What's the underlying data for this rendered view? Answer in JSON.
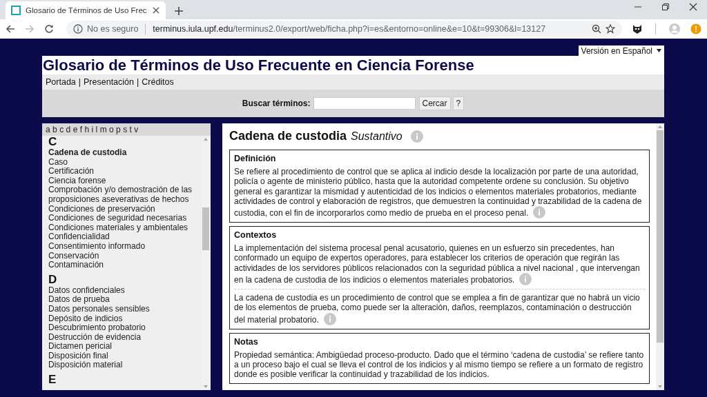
{
  "browser": {
    "tab_title": "Glosario de Términos de Uso Frec",
    "security": "No es seguro",
    "url_host": "terminus.iula.upf.edu",
    "url_path": "/terminus2.0/export/web/ficha.php?i=es&entorno=online&e=10&t=99306&l=13127"
  },
  "language_select": {
    "value": "Versión en Español"
  },
  "header": {
    "title": "Glosario de Términos de Uso Frecuente en Ciencia Forense",
    "nav_separator": "|",
    "nav": [
      "Portada",
      "Presentación",
      "Créditos"
    ],
    "search": {
      "label": "Buscar términos:",
      "button": "Cercar",
      "help": "?"
    }
  },
  "sidebar": {
    "alphabet": [
      "a",
      "b",
      "c",
      "d",
      "e",
      "f",
      "h",
      "i",
      "l",
      "m",
      "o",
      "p",
      "s",
      "t",
      "v"
    ],
    "groups": [
      {
        "letter": "C",
        "items": [
          {
            "label": "Cadena de custodia",
            "selected": true
          },
          {
            "label": "Caso",
            "selected": false
          },
          {
            "label": "Certificación",
            "selected": false
          },
          {
            "label": "Ciencia forense",
            "selected": false
          },
          {
            "label": "Comprobación y/o demostración de las proposiciones aseverativas de hechos",
            "selected": false
          },
          {
            "label": "Condiciones de preservación",
            "selected": false
          },
          {
            "label": "Condiciones de seguridad necesarias",
            "selected": false
          },
          {
            "label": "Condiciones materiales y ambientales",
            "selected": false
          },
          {
            "label": "Confidencialidad",
            "selected": false
          },
          {
            "label": "Consentimiento informado",
            "selected": false
          },
          {
            "label": "Conservación",
            "selected": false
          },
          {
            "label": "Contaminación",
            "selected": false
          }
        ]
      },
      {
        "letter": "D",
        "items": [
          {
            "label": "Datos confidenciales",
            "selected": false
          },
          {
            "label": "Datos de prueba",
            "selected": false
          },
          {
            "label": "Datos personales sensibles",
            "selected": false
          },
          {
            "label": "Depósito de indicios",
            "selected": false
          },
          {
            "label": "Descubrimiento probatorio",
            "selected": false
          },
          {
            "label": "Destrucción de evidencia",
            "selected": false
          },
          {
            "label": "Dictamen pericial",
            "selected": false
          },
          {
            "label": "Disposición final",
            "selected": false
          },
          {
            "label": "Disposición material",
            "selected": false
          }
        ]
      },
      {
        "letter": "E"
      }
    ]
  },
  "entry": {
    "term": "Cadena de custodia",
    "category": "Sustantivo",
    "sections": [
      {
        "heading": "Definición",
        "paragraphs": [
          {
            "text": "Se refiere al procedimiento de control que se aplica al indicio desde la localización por parte de una autoridad, policía o agente de ministerio público, hasta que la autoridad competente ordene su conclusión. Su objetivo general es garantizar la mismidad y autenticidad de los indicios o elementos materiales probatorios, mediante actividades de control y elaboración de registros, que demuestren la continuidad y trazabilidad de la cadena de custodia, con el fin de incorporarlos como medio de prueba en el proceso penal.",
            "info": true
          }
        ]
      },
      {
        "heading": "Contextos",
        "paragraphs": [
          {
            "text": "La implementación del sistema procesal penal acusatorio, quienes en un esfuerzo sin precedentes, han conformado un equipo de expertos operadores, para establecer los criterios de operación que regirán las actividades de los servidores públicos relacionados con la seguridad pública a nivel nacional , que intervengan en la cadena de custodia de los indicios o elementos materiales probatorios.",
            "info": true
          },
          {
            "text": "La cadena de custodia es un procedimiento de control que se emplea a fin de garantizar que no habrá un vicio de los elementos de prueba, como puede ser la alteración, daños, reemplazos, contaminación o destrucción del material probatorio.",
            "info": true
          }
        ]
      },
      {
        "heading": "Notas",
        "paragraphs": [
          {
            "text": "Propiedad semántica: Ambigüedad proceso-producto. Dado que el término ‘cadena de custodia’ se refiere tanto a un proceso bajo el cual se lleva el control de los indicios y al mismo tiempo se refiere a un formato de registro donde es posible verificar la continuidad y trazabilidad de los indicios.",
            "info": false
          }
        ]
      }
    ]
  }
}
